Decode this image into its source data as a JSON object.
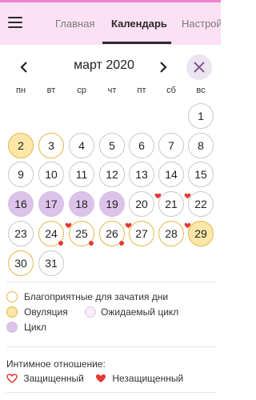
{
  "header": {
    "tabs": [
      {
        "label": "Главная",
        "active": false
      },
      {
        "label": "Календарь",
        "active": true
      },
      {
        "label": "Настрой",
        "active": false
      }
    ]
  },
  "calendar": {
    "month_label": "март 2020",
    "weekdays": [
      "пн",
      "вт",
      "ср",
      "чт",
      "пт",
      "сб",
      "вс"
    ],
    "days": [
      {
        "d": "1",
        "type": "plain"
      },
      {
        "d": "2",
        "type": "ovulation"
      },
      {
        "d": "3",
        "type": "fertile"
      },
      {
        "d": "4",
        "type": "plain"
      },
      {
        "d": "5",
        "type": "plain"
      },
      {
        "d": "6",
        "type": "plain"
      },
      {
        "d": "7",
        "type": "plain"
      },
      {
        "d": "8",
        "type": "plain"
      },
      {
        "d": "9",
        "type": "plain"
      },
      {
        "d": "10",
        "type": "plain"
      },
      {
        "d": "11",
        "type": "plain"
      },
      {
        "d": "12",
        "type": "plain"
      },
      {
        "d": "13",
        "type": "plain"
      },
      {
        "d": "14",
        "type": "plain"
      },
      {
        "d": "15",
        "type": "plain"
      },
      {
        "d": "16",
        "type": "period"
      },
      {
        "d": "17",
        "type": "period"
      },
      {
        "d": "18",
        "type": "period"
      },
      {
        "d": "19",
        "type": "period"
      },
      {
        "d": "20",
        "type": "plain"
      },
      {
        "d": "21",
        "type": "plain",
        "heart": true
      },
      {
        "d": "22",
        "type": "plain",
        "heart": true
      },
      {
        "d": "23",
        "type": "plain"
      },
      {
        "d": "24",
        "type": "fertile",
        "dot": true
      },
      {
        "d": "25",
        "type": "fertile",
        "heart": true,
        "dot": true
      },
      {
        "d": "26",
        "type": "fertile",
        "dot": true
      },
      {
        "d": "27",
        "type": "fertile",
        "heart": true
      },
      {
        "d": "28",
        "type": "fertile"
      },
      {
        "d": "29",
        "type": "ovulation",
        "heart": true
      },
      {
        "d": "30",
        "type": "fertile"
      },
      {
        "d": "31",
        "type": "plain"
      }
    ]
  },
  "legend": {
    "fertile": "Благоприятные для зачатия дни",
    "ovulation": "Овуляция",
    "expected": "Ожидаемый цикл",
    "period": "Цикл"
  },
  "intimacy": {
    "title": "Интимное отношение:",
    "protected": "Защищенный",
    "unprotected": "Незащищенный"
  },
  "colors": {
    "header_bg": "#fbe1f3",
    "header_accent": "#ef7fd0",
    "fertile_border": "#e0b84a",
    "ovulation_fill": "#fce7a9",
    "period_fill": "#dcc3ea",
    "expected_fill": "#f6eef9",
    "heart": "#e53935"
  },
  "icons": {
    "menu": "hamburger-menu-icon",
    "prev": "chevron-left-icon",
    "next": "chevron-right-icon",
    "close": "close-icon",
    "heart": "heart-icon"
  }
}
